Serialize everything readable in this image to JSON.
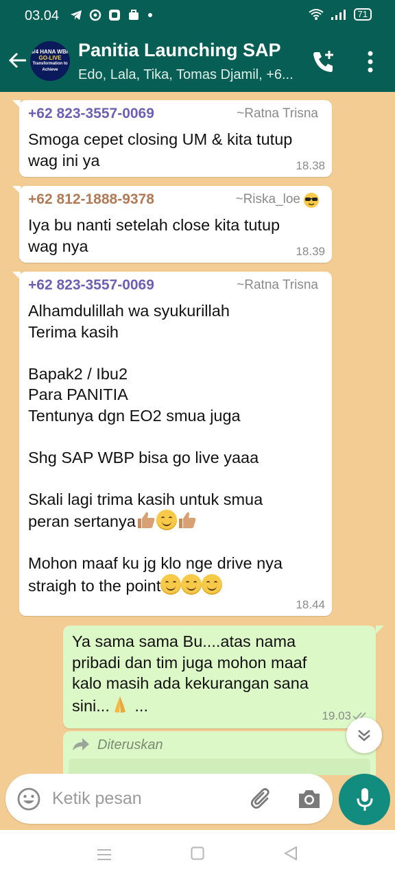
{
  "status_bar": {
    "time": "03.04",
    "battery": "71"
  },
  "header": {
    "group_name": "Panitia Launching SAP",
    "members": "Edo, Lala, Tika, Tomas Djamil, +6...",
    "avatar_text_line1": "S/4 HANA WBP",
    "avatar_text_line2": "GO-LIVE",
    "avatar_text_line3": "Transformation to Achieve"
  },
  "messages": [
    {
      "sender": "+62 823-3557-0069",
      "sender_color": "#6f5fb3",
      "alias": "~Ratna Trisna",
      "lines": [
        "Smoga cepet closing UM & kita tutup",
        "wag ini ya"
      ],
      "time": "18.38"
    },
    {
      "sender": "+62 812-1888-9378",
      "sender_color": "#b07a56",
      "alias": "~Riska_loe",
      "alias_emoji": "sunglasses-face",
      "lines": [
        "Iya bu nanti setelah close kita tutup",
        "wag nya"
      ],
      "time": "18.39"
    },
    {
      "sender": "+62 823-3557-0069",
      "sender_color": "#6f5fb3",
      "alias": "~Ratna Trisna",
      "lines": [
        "Alhamdulillah wa syukurillah",
        "Terima kasih",
        "",
        "Bapak2 / Ibu2",
        "Para PANITIA",
        "Tentunya dgn EO2 smua juga",
        "",
        "Shg SAP WBP bisa go live yaaa",
        "",
        "Skali lagi trima kasih untuk smua",
        "peran sertanya",
        "",
        "Mohon maaf ku jg klo nge drive nya",
        "straigh to the point"
      ],
      "time": "18.44"
    },
    {
      "outgoing": true,
      "lines": [
        "Ya sama sama Bu....atas nama",
        "pribadi dan tim juga mohon maaf",
        "kalo masih ada kekurangan sana",
        "sini..."
      ],
      "trailing": "...",
      "time": "19.03"
    }
  ],
  "forwarded": {
    "label": "Diteruskan"
  },
  "composer": {
    "placeholder": "Ketik pesan"
  },
  "colors": {
    "header": "#075e54",
    "wallpaper": "#f3cc93",
    "outgoing_bubble": "#dcf8c6",
    "mic_button": "#128c7e"
  }
}
